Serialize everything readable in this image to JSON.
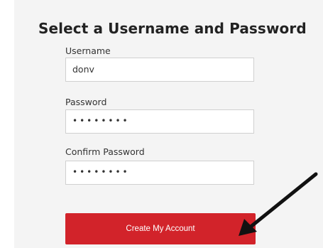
{
  "form": {
    "title": "Select a Username and Password",
    "username_label": "Username",
    "username_value": "donv",
    "password_label": "Password",
    "password_value": "••••••••",
    "confirm_label": "Confirm Password",
    "confirm_value": "••••••••",
    "submit_label": "Create My Account"
  },
  "colors": {
    "panel_background": "#f4f4f4",
    "accent_button": "#d2232a",
    "annotation_arrow": "#111111"
  },
  "icons": {
    "annotation": "arrow-pointer-icon"
  }
}
